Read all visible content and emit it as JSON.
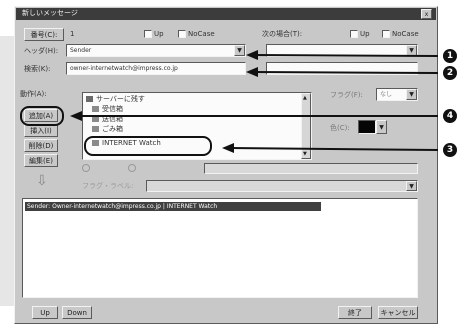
{
  "window": {
    "title": "新しいメッセージ",
    "close_glyph": "x"
  },
  "fields": {
    "folder_label": "番号(C):",
    "folder_value": "1",
    "header_label": "ヘッダ(H):",
    "header_value": "Sender",
    "keyword_label": "検索(K):",
    "keyword_value": "owner-internetwatch@impress.co.jp",
    "option1_label": "Up",
    "option2_label": "NoCase",
    "option3_label": "Up",
    "option4_label": "NoCase",
    "mid_label": "次の場合(T):"
  },
  "actions": {
    "label": "動作(A):",
    "add_label": "追加(A)",
    "insert_label": "挿入(I)",
    "delete_label": "削除(D)",
    "edit_label": "編集(E)",
    "items": [
      "サーバーに残す",
      "受信箱",
      "送信箱",
      "ごみ箱",
      "INTERNET Watch"
    ]
  },
  "right_panel": {
    "label": "フラグ(F):",
    "select_value": "なし",
    "color_label": "色(C):"
  },
  "misc": {
    "arrow_down": "⇩",
    "sub_label": "フラグ・ラベル:"
  },
  "rule_text": "Sender: Owner-internetwatch@impress.co.jp | INTERNET Watch",
  "bottom": {
    "up_label": "Up",
    "down_label": "Down",
    "ok_label": "終了",
    "cancel_label": "キャンセル"
  },
  "callouts": [
    "1",
    "2",
    "3",
    "4"
  ],
  "colors": {
    "dialog_bg": "#c8c8c8",
    "title_bar": "#3c3c3c",
    "highlight_bar": "#404040",
    "callout": "#111111"
  }
}
